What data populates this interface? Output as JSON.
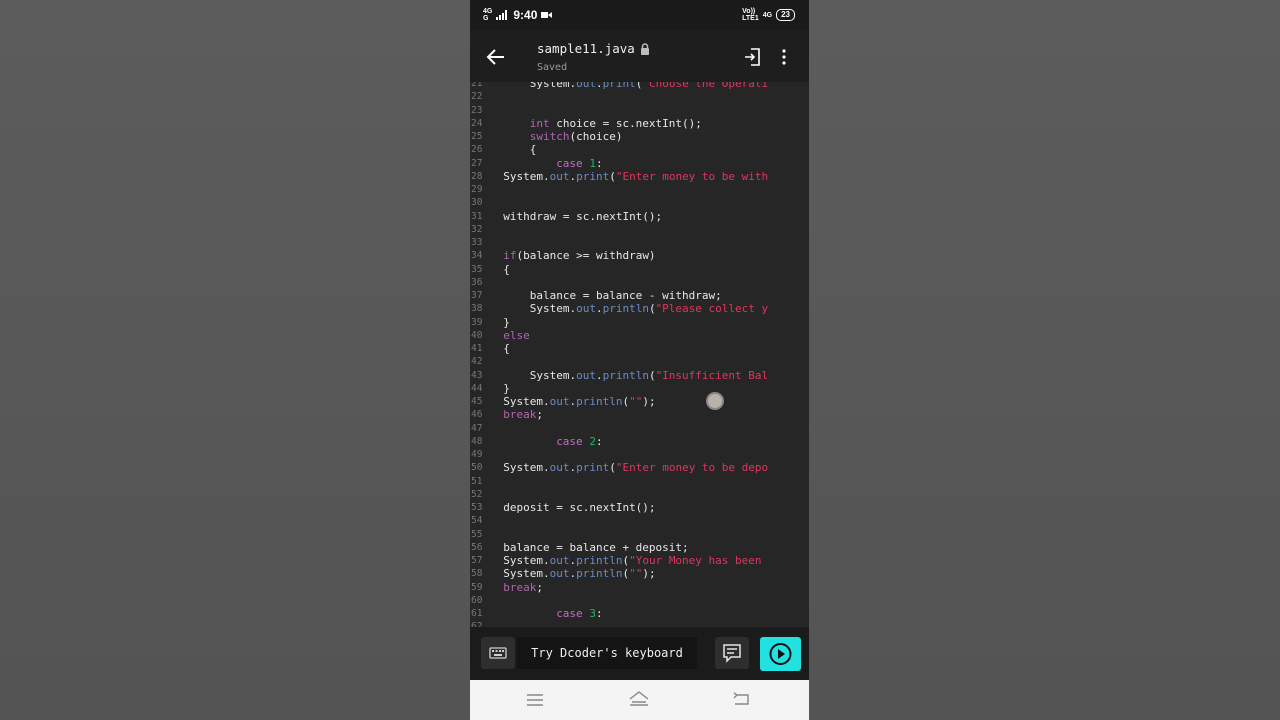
{
  "status_bar": {
    "time": "9:40",
    "net_left_1": "4G",
    "net_left_2": "G",
    "volte_top": "Vo))",
    "volte_bottom": "LTE1",
    "net_right": "4G",
    "battery": "23"
  },
  "app_bar": {
    "file_name": "sample11.java",
    "save_status": "Saved"
  },
  "editor": {
    "lines": [
      {
        "n": "21",
        "indent": 6,
        "parts": [
          {
            "t": "System.",
            "c": "plain"
          },
          {
            "t": "out",
            "c": "fld"
          },
          {
            "t": ".",
            "c": "plain"
          },
          {
            "t": "print",
            "c": "fld"
          },
          {
            "t": "(",
            "c": "plain"
          },
          {
            "t": "\"Choose the Operati",
            "c": "str"
          }
        ]
      },
      {
        "n": "22",
        "indent": 0,
        "parts": []
      },
      {
        "n": "23",
        "indent": 0,
        "parts": []
      },
      {
        "n": "24",
        "indent": 6,
        "parts": [
          {
            "t": "int",
            "c": "kw"
          },
          {
            "t": " choice = sc.nextInt();",
            "c": "plain"
          }
        ]
      },
      {
        "n": "25",
        "indent": 6,
        "parts": [
          {
            "t": "switch",
            "c": "kw"
          },
          {
            "t": "(choice)",
            "c": "plain"
          }
        ]
      },
      {
        "n": "26",
        "indent": 6,
        "parts": [
          {
            "t": "{",
            "c": "plain"
          }
        ]
      },
      {
        "n": "27",
        "indent": 10,
        "parts": [
          {
            "t": "case",
            "c": "cse"
          },
          {
            "t": " ",
            "c": "plain"
          },
          {
            "t": "1",
            "c": "num"
          },
          {
            "t": ":",
            "c": "plain"
          }
        ]
      },
      {
        "n": "28",
        "indent": 2,
        "parts": [
          {
            "t": "System.",
            "c": "plain"
          },
          {
            "t": "out",
            "c": "fld"
          },
          {
            "t": ".",
            "c": "plain"
          },
          {
            "t": "print",
            "c": "fld"
          },
          {
            "t": "(",
            "c": "plain"
          },
          {
            "t": "\"Enter money to be with",
            "c": "str"
          }
        ]
      },
      {
        "n": "29",
        "indent": 0,
        "parts": []
      },
      {
        "n": "30",
        "indent": 0,
        "parts": []
      },
      {
        "n": "31",
        "indent": 2,
        "parts": [
          {
            "t": "withdraw = sc.nextInt();",
            "c": "plain"
          }
        ]
      },
      {
        "n": "32",
        "indent": 0,
        "parts": []
      },
      {
        "n": "33",
        "indent": 0,
        "parts": []
      },
      {
        "n": "34",
        "indent": 2,
        "parts": [
          {
            "t": "if",
            "c": "kw"
          },
          {
            "t": "(balance >= withdraw)",
            "c": "plain"
          }
        ]
      },
      {
        "n": "35",
        "indent": 2,
        "parts": [
          {
            "t": "{",
            "c": "plain"
          }
        ]
      },
      {
        "n": "36",
        "indent": 0,
        "parts": []
      },
      {
        "n": "37",
        "indent": 6,
        "parts": [
          {
            "t": "balance = balance - withdraw;",
            "c": "plain"
          }
        ]
      },
      {
        "n": "38",
        "indent": 6,
        "parts": [
          {
            "t": "System.",
            "c": "plain"
          },
          {
            "t": "out",
            "c": "fld"
          },
          {
            "t": ".",
            "c": "plain"
          },
          {
            "t": "println",
            "c": "fld"
          },
          {
            "t": "(",
            "c": "plain"
          },
          {
            "t": "\"Please collect y",
            "c": "str"
          }
        ]
      },
      {
        "n": "39",
        "indent": 2,
        "parts": [
          {
            "t": "}",
            "c": "plain"
          }
        ]
      },
      {
        "n": "40",
        "indent": 2,
        "parts": [
          {
            "t": "else",
            "c": "kw"
          }
        ]
      },
      {
        "n": "41",
        "indent": 2,
        "parts": [
          {
            "t": "{",
            "c": "plain"
          }
        ]
      },
      {
        "n": "42",
        "indent": 0,
        "parts": []
      },
      {
        "n": "43",
        "indent": 6,
        "parts": [
          {
            "t": "System.",
            "c": "plain"
          },
          {
            "t": "out",
            "c": "fld"
          },
          {
            "t": ".",
            "c": "plain"
          },
          {
            "t": "println",
            "c": "fld"
          },
          {
            "t": "(",
            "c": "plain"
          },
          {
            "t": "\"Insufficient Bal",
            "c": "str"
          }
        ]
      },
      {
        "n": "44",
        "indent": 2,
        "parts": [
          {
            "t": "}",
            "c": "plain"
          }
        ]
      },
      {
        "n": "45",
        "indent": 2,
        "parts": [
          {
            "t": "System.",
            "c": "plain"
          },
          {
            "t": "out",
            "c": "fld"
          },
          {
            "t": ".",
            "c": "plain"
          },
          {
            "t": "println",
            "c": "fld"
          },
          {
            "t": "(",
            "c": "plain"
          },
          {
            "t": "\"\"",
            "c": "str"
          },
          {
            "t": ");",
            "c": "plain"
          }
        ]
      },
      {
        "n": "46",
        "indent": 2,
        "parts": [
          {
            "t": "break",
            "c": "kw"
          },
          {
            "t": ";",
            "c": "plain"
          }
        ]
      },
      {
        "n": "47",
        "indent": 0,
        "parts": []
      },
      {
        "n": "48",
        "indent": 10,
        "parts": [
          {
            "t": "case",
            "c": "cse"
          },
          {
            "t": " ",
            "c": "plain"
          },
          {
            "t": "2",
            "c": "num"
          },
          {
            "t": ":",
            "c": "plain"
          }
        ]
      },
      {
        "n": "49",
        "indent": 0,
        "parts": []
      },
      {
        "n": "50",
        "indent": 2,
        "parts": [
          {
            "t": "System.",
            "c": "plain"
          },
          {
            "t": "out",
            "c": "fld"
          },
          {
            "t": ".",
            "c": "plain"
          },
          {
            "t": "print",
            "c": "fld"
          },
          {
            "t": "(",
            "c": "plain"
          },
          {
            "t": "\"Enter money to be depo",
            "c": "str"
          }
        ]
      },
      {
        "n": "51",
        "indent": 0,
        "parts": []
      },
      {
        "n": "52",
        "indent": 0,
        "parts": []
      },
      {
        "n": "53",
        "indent": 2,
        "parts": [
          {
            "t": "deposit = sc.nextInt();",
            "c": "plain"
          }
        ]
      },
      {
        "n": "54",
        "indent": 0,
        "parts": []
      },
      {
        "n": "55",
        "indent": 0,
        "parts": []
      },
      {
        "n": "56",
        "indent": 2,
        "parts": [
          {
            "t": "balance = balance + deposit;",
            "c": "plain"
          }
        ]
      },
      {
        "n": "57",
        "indent": 2,
        "parts": [
          {
            "t": "System.",
            "c": "plain"
          },
          {
            "t": "out",
            "c": "fld"
          },
          {
            "t": ".",
            "c": "plain"
          },
          {
            "t": "println",
            "c": "fld"
          },
          {
            "t": "(",
            "c": "plain"
          },
          {
            "t": "\"Your Money has been",
            "c": "str"
          }
        ]
      },
      {
        "n": "58",
        "indent": 2,
        "parts": [
          {
            "t": "System.",
            "c": "plain"
          },
          {
            "t": "out",
            "c": "fld"
          },
          {
            "t": ".",
            "c": "plain"
          },
          {
            "t": "println",
            "c": "fld"
          },
          {
            "t": "(",
            "c": "plain"
          },
          {
            "t": "\"\"",
            "c": "str"
          },
          {
            "t": ");",
            "c": "plain"
          }
        ]
      },
      {
        "n": "59",
        "indent": 2,
        "parts": [
          {
            "t": "break",
            "c": "kw"
          },
          {
            "t": ";",
            "c": "plain"
          }
        ]
      },
      {
        "n": "60",
        "indent": 0,
        "parts": []
      },
      {
        "n": "61",
        "indent": 10,
        "parts": [
          {
            "t": "case",
            "c": "cse"
          },
          {
            "t": " ",
            "c": "plain"
          },
          {
            "t": "3",
            "c": "num"
          },
          {
            "t": ":",
            "c": "plain"
          }
        ]
      },
      {
        "n": "62",
        "indent": 0,
        "parts": []
      }
    ]
  },
  "bottom_bar": {
    "keyboard_prompt": "Try Dcoder's keyboard",
    "run_color": "#22e1e1"
  },
  "icons": [
    "back-arrow-icon",
    "lock-icon",
    "exit-icon",
    "more-vertical-icon",
    "keyboard-icon",
    "chat-icon",
    "play-icon",
    "recent-apps-icon",
    "home-icon",
    "back-nav-icon"
  ]
}
